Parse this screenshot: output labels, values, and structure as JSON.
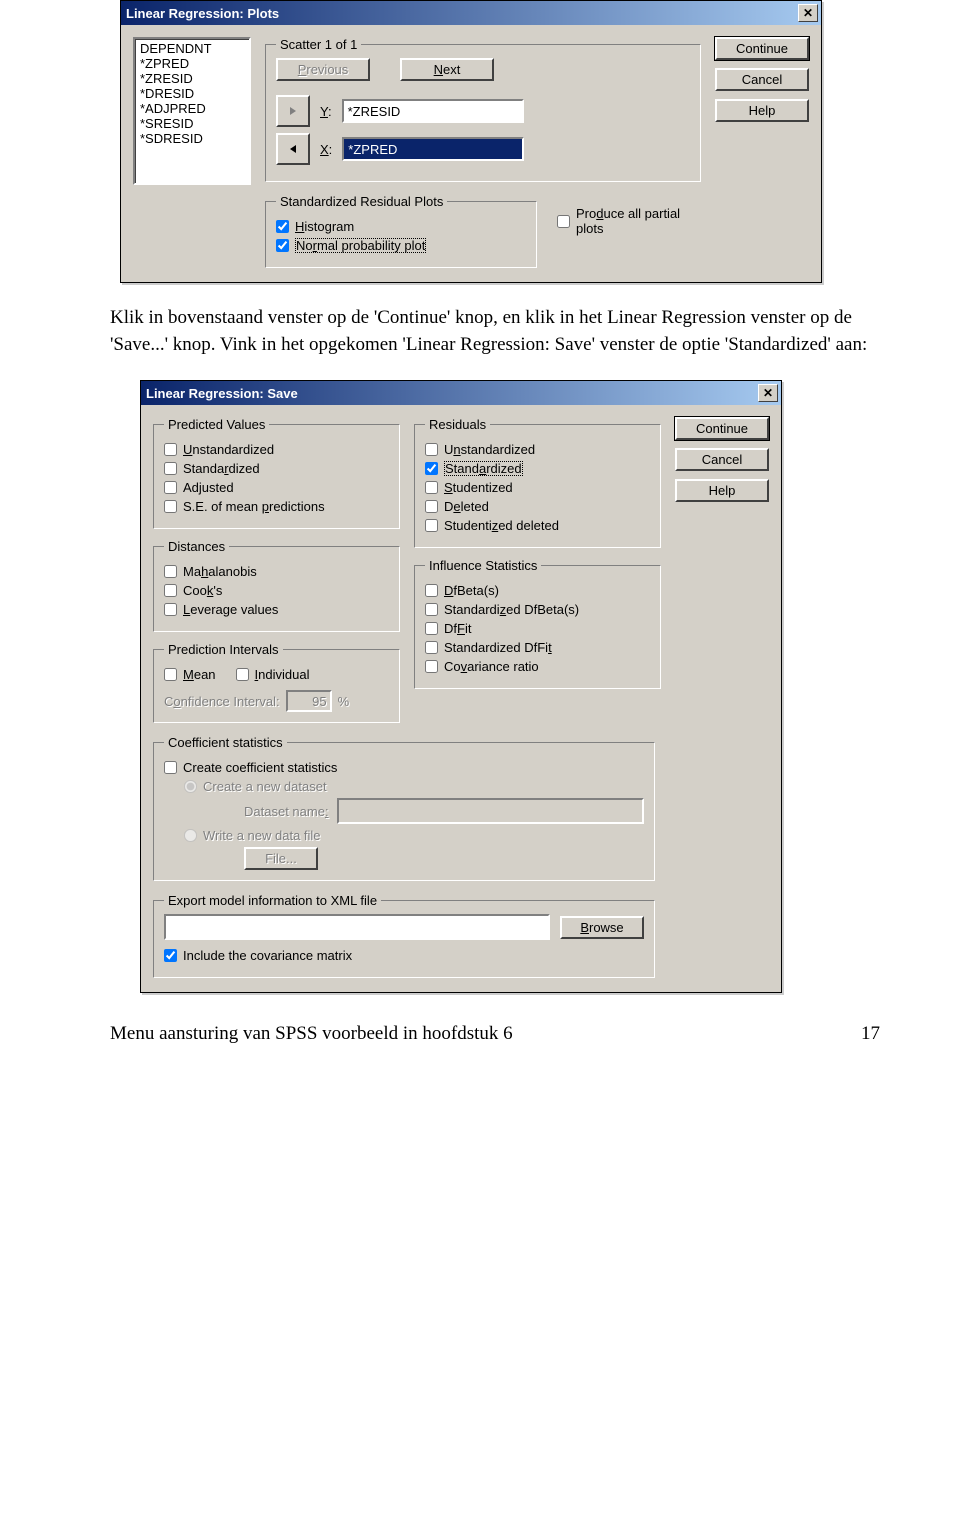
{
  "plots_dialog": {
    "title": "Linear Regression: Plots",
    "listbox": [
      "DEPENDNT",
      "*ZPRED",
      "*ZRESID",
      "*DRESID",
      "*ADJPRED",
      "*SRESID",
      "*SDRESID"
    ],
    "scatter_legend": "Scatter 1 of 1",
    "prev_btn": "Previous",
    "next_btn": "Next",
    "y_label": "Y:",
    "y_value": "*ZRESID",
    "x_label": "X:",
    "x_value": "*ZPRED",
    "resid_legend": "Standardized Residual Plots",
    "histogram": "Histogram",
    "normal_prob": "Normal probability plot",
    "partial": "Produce all partial plots",
    "continue": "Continue",
    "cancel": "Cancel",
    "help": "Help"
  },
  "caption1": "Klik in bovenstaand venster op de 'Continue' knop, en klik in het Linear Regression venster op de 'Save...' knop. Vink in het opgekomen 'Linear Regression: Save' venster de optie 'Standardized' aan:",
  "save_dialog": {
    "title": "Linear Regression: Save",
    "predicted_legend": "Predicted Values",
    "pv_unstd": "Unstandardized",
    "pv_std": "Standardized",
    "pv_adj": "Adjusted",
    "pv_se": "S.E. of mean predictions",
    "distances_legend": "Distances",
    "d_mah": "Mahalanobis",
    "d_cook": "Cook's",
    "d_lev": "Leverage values",
    "pi_legend": "Prediction Intervals",
    "pi_mean": "Mean",
    "pi_ind": "Individual",
    "pi_conf_label": "Confidence Interval:",
    "pi_conf_val": "95",
    "pi_pct": "%",
    "resid_legend": "Residuals",
    "r_unstd": "Unstandardized",
    "r_std": "Standardized",
    "r_stu": "Studentized",
    "r_del": "Deleted",
    "r_sdel": "Studentized deleted",
    "inf_legend": "Influence Statistics",
    "i_dfbeta": "DfBeta(s)",
    "i_sdfbeta": "Standardized DfBeta(s)",
    "i_dffit": "DfFit",
    "i_sdffit": "Standardized DfFit",
    "i_cov": "Covariance ratio",
    "coef_legend": "Coefficient statistics",
    "coef_create": "Create coefficient statistics",
    "coef_newds": "Create a new dataset",
    "coef_dsname": "Dataset name:",
    "coef_write": "Write a new data file",
    "coef_file": "File...",
    "xml_legend": "Export model information to XML file",
    "xml_browse": "Browse",
    "xml_include": "Include the covariance matrix",
    "continue": "Continue",
    "cancel": "Cancel",
    "help": "Help"
  },
  "footer_left": "Menu aansturing van SPSS voorbeeld in hoofdstuk 6",
  "footer_right": "17"
}
